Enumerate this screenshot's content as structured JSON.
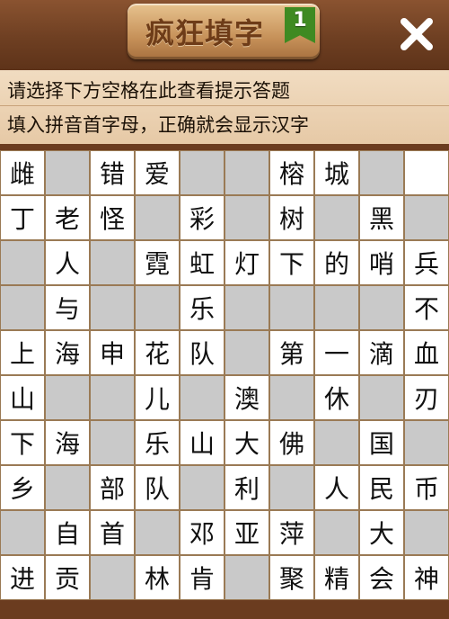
{
  "header": {
    "title": "疯狂填字",
    "level": "1",
    "close_icon": "close-icon"
  },
  "hint": {
    "line1": "请选择下方空格在此查看提示答题",
    "line2": "填入拼音首字母，正确就会显示汉字"
  },
  "colors": {
    "wood": "#6b3c1f",
    "plaque": "#c7925a",
    "ribbon": "#3f8a22",
    "hint_bg": "#ecd4b5",
    "cell_white": "#ffffff",
    "cell_gray": "#c9c9c9"
  },
  "grid": {
    "rows": [
      [
        {
          "t": "w",
          "c": "雌"
        },
        {
          "t": "g",
          "c": ""
        },
        {
          "t": "w",
          "c": "错"
        },
        {
          "t": "w",
          "c": "爱"
        },
        {
          "t": "g",
          "c": ""
        },
        {
          "t": "g",
          "c": ""
        },
        {
          "t": "w",
          "c": "榕"
        },
        {
          "t": "w",
          "c": "城"
        },
        {
          "t": "g",
          "c": ""
        },
        {
          "t": "w",
          "c": ""
        }
      ],
      [
        {
          "t": "w",
          "c": "丁"
        },
        {
          "t": "w",
          "c": "老"
        },
        {
          "t": "w",
          "c": "怪"
        },
        {
          "t": "g",
          "c": ""
        },
        {
          "t": "w",
          "c": "彩"
        },
        {
          "t": "g",
          "c": ""
        },
        {
          "t": "w",
          "c": "树"
        },
        {
          "t": "g",
          "c": ""
        },
        {
          "t": "w",
          "c": "黑"
        },
        {
          "t": "g",
          "c": ""
        }
      ],
      [
        {
          "t": "g",
          "c": ""
        },
        {
          "t": "w",
          "c": "人"
        },
        {
          "t": "g",
          "c": ""
        },
        {
          "t": "w",
          "c": "霓"
        },
        {
          "t": "w",
          "c": "虹"
        },
        {
          "t": "w",
          "c": "灯"
        },
        {
          "t": "w",
          "c": "下"
        },
        {
          "t": "w",
          "c": "的"
        },
        {
          "t": "w",
          "c": "哨"
        },
        {
          "t": "w",
          "c": "兵"
        }
      ],
      [
        {
          "t": "g",
          "c": ""
        },
        {
          "t": "w",
          "c": "与"
        },
        {
          "t": "g",
          "c": ""
        },
        {
          "t": "g",
          "c": ""
        },
        {
          "t": "w",
          "c": "乐"
        },
        {
          "t": "g",
          "c": ""
        },
        {
          "t": "g",
          "c": ""
        },
        {
          "t": "g",
          "c": ""
        },
        {
          "t": "g",
          "c": ""
        },
        {
          "t": "w",
          "c": "不"
        }
      ],
      [
        {
          "t": "w",
          "c": "上"
        },
        {
          "t": "w",
          "c": "海"
        },
        {
          "t": "w",
          "c": "申"
        },
        {
          "t": "w",
          "c": "花"
        },
        {
          "t": "w",
          "c": "队"
        },
        {
          "t": "g",
          "c": ""
        },
        {
          "t": "w",
          "c": "第"
        },
        {
          "t": "w",
          "c": "一"
        },
        {
          "t": "w",
          "c": "滴"
        },
        {
          "t": "w",
          "c": "血"
        }
      ],
      [
        {
          "t": "w",
          "c": "山"
        },
        {
          "t": "g",
          "c": ""
        },
        {
          "t": "g",
          "c": ""
        },
        {
          "t": "w",
          "c": "儿"
        },
        {
          "t": "g",
          "c": ""
        },
        {
          "t": "w",
          "c": "澳"
        },
        {
          "t": "g",
          "c": ""
        },
        {
          "t": "w",
          "c": "休"
        },
        {
          "t": "g",
          "c": ""
        },
        {
          "t": "w",
          "c": "刃"
        }
      ],
      [
        {
          "t": "w",
          "c": "下"
        },
        {
          "t": "w",
          "c": "海"
        },
        {
          "t": "g",
          "c": ""
        },
        {
          "t": "w",
          "c": "乐"
        },
        {
          "t": "w",
          "c": "山"
        },
        {
          "t": "w",
          "c": "大"
        },
        {
          "t": "w",
          "c": "佛"
        },
        {
          "t": "g",
          "c": ""
        },
        {
          "t": "w",
          "c": "国"
        },
        {
          "t": "g",
          "c": ""
        }
      ],
      [
        {
          "t": "w",
          "c": "乡"
        },
        {
          "t": "g",
          "c": ""
        },
        {
          "t": "w",
          "c": "部"
        },
        {
          "t": "w",
          "c": "队"
        },
        {
          "t": "g",
          "c": ""
        },
        {
          "t": "w",
          "c": "利"
        },
        {
          "t": "g",
          "c": ""
        },
        {
          "t": "w",
          "c": "人"
        },
        {
          "t": "w",
          "c": "民"
        },
        {
          "t": "w",
          "c": "币"
        }
      ],
      [
        {
          "t": "g",
          "c": ""
        },
        {
          "t": "w",
          "c": "自"
        },
        {
          "t": "w",
          "c": "首"
        },
        {
          "t": "g",
          "c": ""
        },
        {
          "t": "w",
          "c": "邓"
        },
        {
          "t": "w",
          "c": "亚"
        },
        {
          "t": "w",
          "c": "萍"
        },
        {
          "t": "g",
          "c": ""
        },
        {
          "t": "w",
          "c": "大"
        },
        {
          "t": "g",
          "c": ""
        }
      ],
      [
        {
          "t": "w",
          "c": "进"
        },
        {
          "t": "w",
          "c": "贡"
        },
        {
          "t": "g",
          "c": ""
        },
        {
          "t": "w",
          "c": "林"
        },
        {
          "t": "w",
          "c": "肯"
        },
        {
          "t": "g",
          "c": ""
        },
        {
          "t": "w",
          "c": "聚"
        },
        {
          "t": "w",
          "c": "精"
        },
        {
          "t": "w",
          "c": "会"
        },
        {
          "t": "w",
          "c": "神"
        }
      ]
    ]
  }
}
